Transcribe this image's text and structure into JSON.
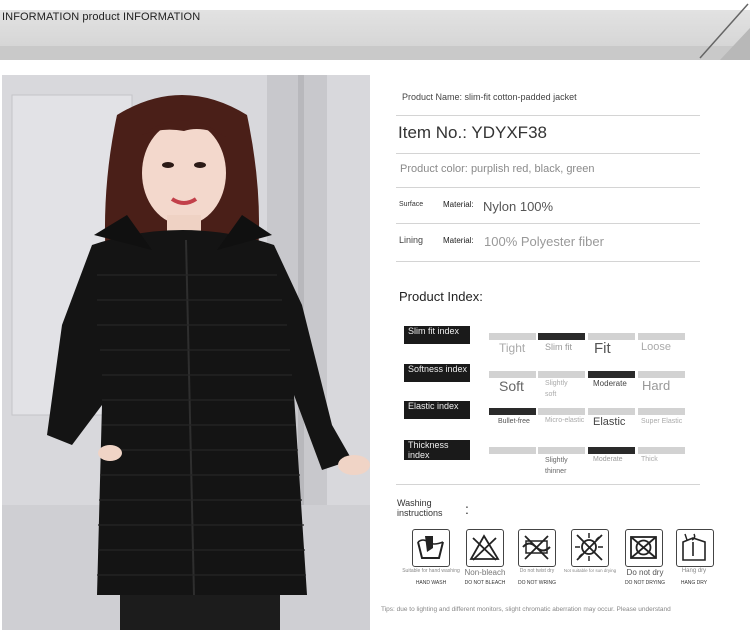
{
  "header": {
    "title": "INFORMATION product INFORMATION"
  },
  "product": {
    "name_label": "Product Name:",
    "name_value": "slim-fit cotton-padded jacket",
    "item_label": "Item No.:",
    "item_value": "YDYXF38",
    "color_label": "Product color:",
    "color_value": "purplish red, black, green",
    "surface_label": "Surface",
    "material_label": "Material:",
    "surface_value": "Nylon 100%",
    "lining_label": "Lining",
    "lining_value": "100% Polyester fiber"
  },
  "index": {
    "title": "Product Index:",
    "rows": [
      {
        "label": "Slim fit index",
        "options": [
          "Tight",
          "Slim fit",
          "Fit",
          "Loose"
        ],
        "selected": 1
      },
      {
        "label": "Softness index",
        "options": [
          "Soft",
          "Slightly soft",
          "Moderate",
          "Hard"
        ],
        "selected": 2
      },
      {
        "label": "Elastic index",
        "options": [
          "Bullet-free",
          "Micro-elastic",
          "Elastic",
          "Super Elastic"
        ],
        "selected": 0
      },
      {
        "label": "Thickness index",
        "options": [
          "",
          "Slightly thinner",
          "Moderate",
          "Thick"
        ],
        "selected": 2
      }
    ]
  },
  "washing": {
    "title": "Washing instructions",
    "colon": ":",
    "icons": [
      {
        "name": "hand-wash-icon",
        "caption": "Suitable for hand washing",
        "caption2": "HAND WASH"
      },
      {
        "name": "non-bleach-icon",
        "caption": "Non-bleach",
        "caption2": "DO NOT BLEACH"
      },
      {
        "name": "no-wring-icon",
        "caption": "Do not twist dry",
        "caption2": "DO NOT WRING"
      },
      {
        "name": "no-tumble-dry-icon",
        "caption": "Not suitable for sun drying",
        "caption2": ""
      },
      {
        "name": "do-not-dry-icon",
        "caption": "Do not dry",
        "caption2": "DO NOT DRYING"
      },
      {
        "name": "hang-dry-icon",
        "caption": "Hang dry",
        "caption2": "HANG DRY"
      }
    ]
  },
  "footer": {
    "tips": "Tips: due to lighting and different monitors, slight chromatic aberration may occur. Please understand"
  }
}
